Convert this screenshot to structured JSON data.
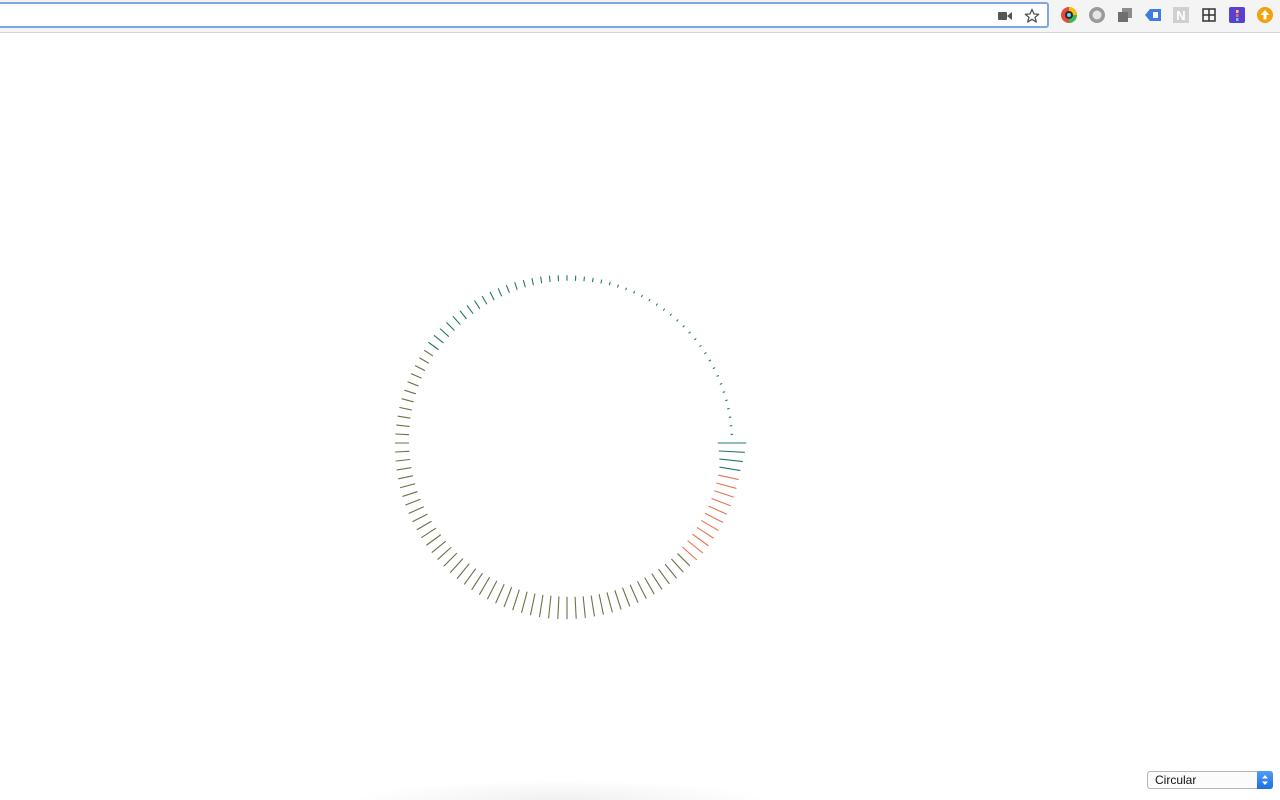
{
  "browser": {
    "address_value": "",
    "icons": {
      "camera": "video-camera-icon",
      "bookmark": "star-icon"
    },
    "extensions": [
      {
        "name": "color-picker-extension-icon"
      },
      {
        "name": "gray-circle-extension-icon"
      },
      {
        "name": "stacked-windows-extension-icon"
      },
      {
        "name": "blue-tag-extension-icon"
      },
      {
        "name": "n-extension-icon",
        "glyph": "N"
      },
      {
        "name": "grid-extension-icon"
      },
      {
        "name": "purple-tile-extension-icon"
      },
      {
        "name": "orange-upload-extension-icon"
      }
    ]
  },
  "visualization": {
    "layout": "circular",
    "colors": {
      "teal": "#1f7a6a",
      "orange": "#e8734f",
      "olive": "#6e7048"
    }
  },
  "controls": {
    "mode_select": {
      "selected": "Circular"
    }
  }
}
